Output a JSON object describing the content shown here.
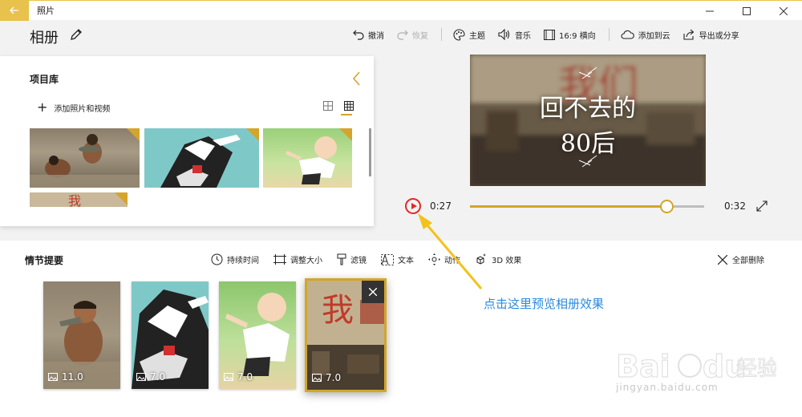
{
  "window": {
    "title": "照片",
    "back_icon": "back-arrow-icon",
    "accent": "#e8c24c"
  },
  "header": {
    "album_title": "相册",
    "toolbar": {
      "undo": "撤消",
      "redo": "恢复",
      "theme": "主题",
      "music": "音乐",
      "aspect": "16:9 横向",
      "cloud": "添加到云",
      "export": "导出或分享"
    }
  },
  "library": {
    "title": "项目库",
    "add_media": "添加照片和视频"
  },
  "preview": {
    "line1": "回不去的",
    "line2": "80后",
    "current_time": "0:27",
    "end_time": "0:32",
    "progress": 0.84
  },
  "storyboard": {
    "title": "情节提要",
    "tools": {
      "duration": "持续时间",
      "resize": "调整大小",
      "filter": "滤镜",
      "text": "文本",
      "motion": "动作",
      "effects": "3D 效果"
    },
    "delete_all": "全部删除",
    "cards": [
      {
        "duration": "11.0"
      },
      {
        "duration": "7.0"
      },
      {
        "duration": "7.0"
      },
      {
        "duration": "7.0"
      }
    ]
  },
  "annotation": {
    "text": "点击这里预览相册效果",
    "color": "#2a8ae0"
  },
  "watermark": {
    "url": "jingyan.baidu.com"
  }
}
